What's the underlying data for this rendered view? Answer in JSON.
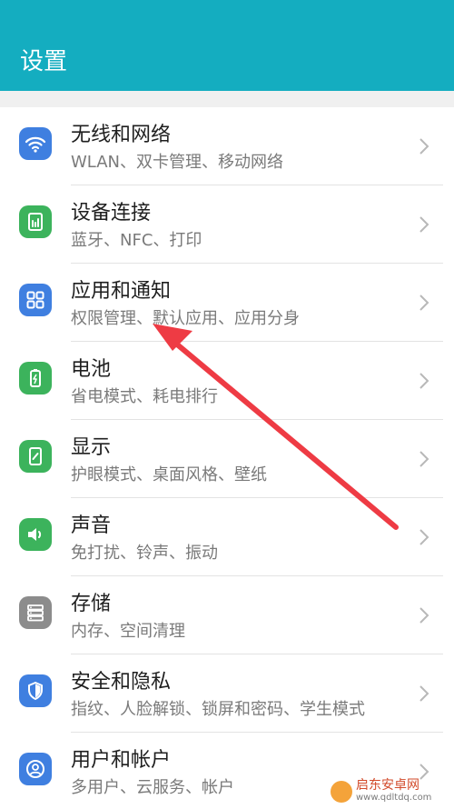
{
  "header": {
    "title": "设置"
  },
  "items": [
    {
      "title": "无线和网络",
      "subtitle": "WLAN、双卡管理、移动网络",
      "icon": "wifi-icon",
      "color": "#3f7fe0"
    },
    {
      "title": "设备连接",
      "subtitle": "蓝牙、NFC、打印",
      "icon": "device-connect-icon",
      "color": "#3cb35c"
    },
    {
      "title": "应用和通知",
      "subtitle": "权限管理、默认应用、应用分身",
      "icon": "apps-grid-icon",
      "color": "#3f7fe0"
    },
    {
      "title": "电池",
      "subtitle": "省电模式、耗电排行",
      "icon": "battery-icon",
      "color": "#3cb35c"
    },
    {
      "title": "显示",
      "subtitle": "护眼模式、桌面风格、壁纸",
      "icon": "display-icon",
      "color": "#3cb35c"
    },
    {
      "title": "声音",
      "subtitle": "免打扰、铃声、振动",
      "icon": "speaker-icon",
      "color": "#3cb35c"
    },
    {
      "title": "存储",
      "subtitle": "内存、空间清理",
      "icon": "storage-icon",
      "color": "#8c8c8c"
    },
    {
      "title": "安全和隐私",
      "subtitle": "指纹、人脸解锁、锁屏和密码、学生模式",
      "icon": "shield-icon",
      "color": "#3f7fe0"
    },
    {
      "title": "用户和帐户",
      "subtitle": "多用户、云服务、帐户",
      "icon": "user-account-icon",
      "color": "#3f7fe0"
    }
  ],
  "annotation": {
    "color": "#ee3b44"
  },
  "watermark": {
    "text": "启东安卓网",
    "url": "www.qdltdq.com"
  }
}
